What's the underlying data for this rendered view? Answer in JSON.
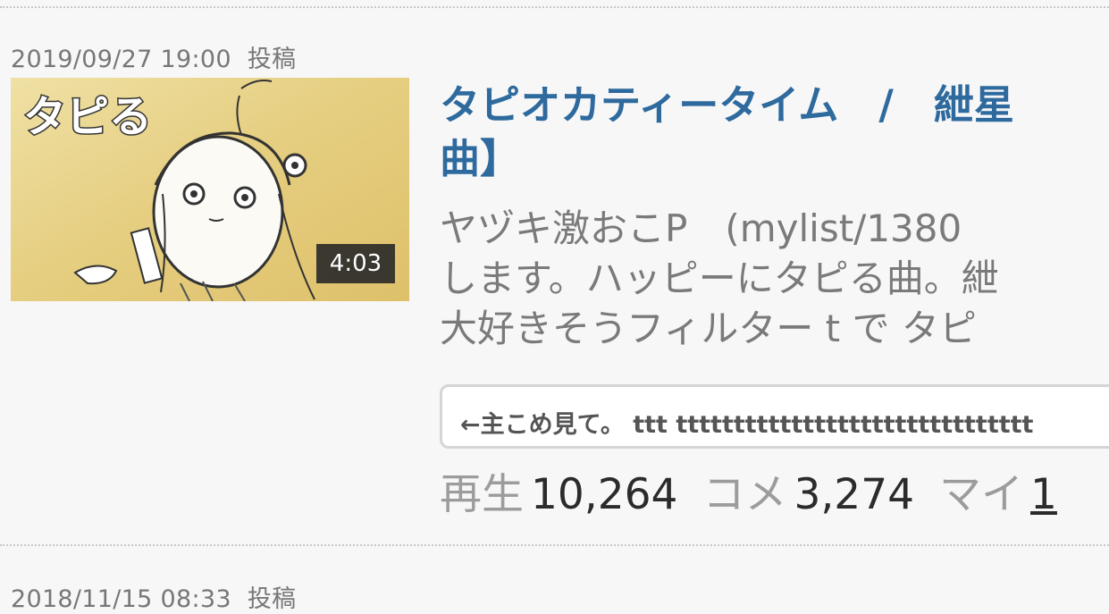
{
  "posts": [
    {
      "date": "2019/09/27 19:00",
      "posted_label": "投稿",
      "thumbnail": {
        "logo_text": "タピる",
        "duration": "4:03",
        "colors": {
          "bg": "#e9d58e",
          "ink": "#333333"
        }
      },
      "title_line1": "タピオカティータイム　/　紲星",
      "title_line2": "曲】",
      "description": [
        "ヤヅキ激おこP　(mylist/1380",
        "します。ハッピーにタピる曲。紲",
        "大好きそうフィルター t で タピ"
      ],
      "comment_preview": "←主こめ見て。 ttt ttttttttttttttttttttttttttttttt",
      "stats": {
        "views_label": "再生",
        "views": "10,264",
        "comments_label": "コメ",
        "comments": "3,274",
        "mylist_label": "マイ",
        "mylist": "1"
      }
    },
    {
      "date": "2018/11/15 08:33",
      "posted_label": "投稿"
    }
  ],
  "colors": {
    "title": "#2e6a9e",
    "background": "#f7f7f7",
    "muted_text": "#7a7a7a"
  }
}
